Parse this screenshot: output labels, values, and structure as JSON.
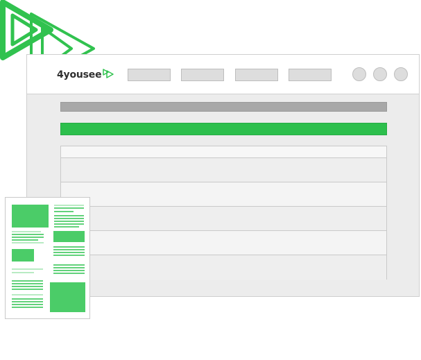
{
  "brand": {
    "name": "4yousee",
    "logo_icon": "play-arrows-icon",
    "logo_color": "#31c24f"
  },
  "decorative": {
    "large_logo_icon": "play-arrows-outline-icon",
    "outline_color": "#31c24f"
  },
  "window": {
    "nav_tabs": [
      "",
      "",
      "",
      ""
    ],
    "window_controls": [
      "",
      "",
      ""
    ]
  },
  "content": {
    "accent_color": "#2dbf4d",
    "rows": 6
  },
  "document": {
    "icon": "document-preview-icon",
    "accent_color": "#4bcc68"
  }
}
